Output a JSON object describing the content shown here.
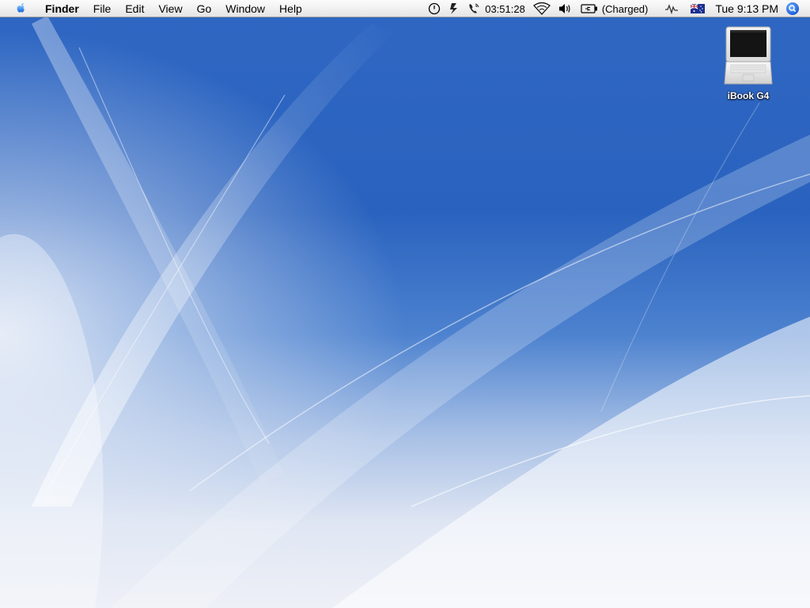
{
  "menubar": {
    "apple_icon": "apple-logo-icon",
    "app_name": "Finder",
    "menus": [
      "File",
      "Edit",
      "View",
      "Go",
      "Window",
      "Help"
    ],
    "status": {
      "timer_icon": "timer-icon",
      "script_icon": "scripts-icon",
      "phone_icon": "phone-icon",
      "phone_time": "03:51:28",
      "wifi_icon": "wifi-icon",
      "volume_icon": "volume-icon",
      "battery_icon": "battery-icon",
      "battery_text": "(Charged)",
      "activity_icon": "activity-icon",
      "input_flag_icon": "australia-flag-icon",
      "clock": "Tue 9:13 PM",
      "spotlight_icon": "spotlight-icon"
    }
  },
  "desktop": {
    "icons": [
      {
        "label": "iBook G4",
        "icon": "laptop-icon"
      }
    ]
  },
  "colors": {
    "wallpaper_blue": "#2a63bf",
    "wallpaper_light": "#eef0f7",
    "menubar": "#f1f1f1"
  }
}
